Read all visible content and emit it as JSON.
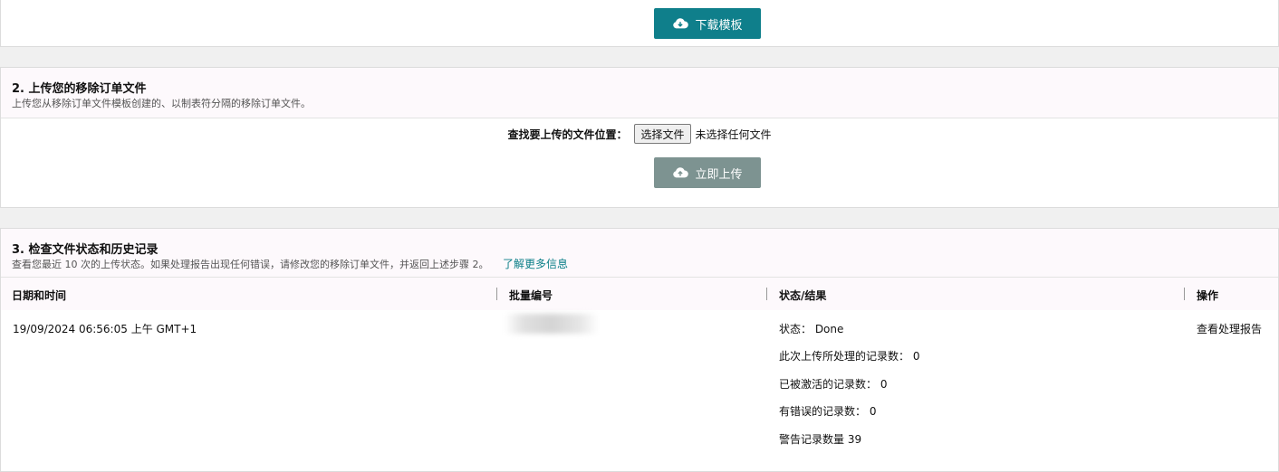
{
  "download": {
    "button_label": "下载模板",
    "icon": "cloud-download-icon"
  },
  "upload": {
    "title": "2. 上传您的移除订单文件",
    "subtitle": "上传您从移除订单文件模板创建的、以制表符分隔的移除订单文件。",
    "file_label": "查找要上传的文件位置：",
    "choose_button": "选择文件",
    "file_status": "未选择任何文件",
    "button_label": "立即上传",
    "icon": "cloud-upload-icon"
  },
  "history": {
    "title": "3. 检查文件状态和历史记录",
    "subtitle": "查看您最近 10 次的上传状态。如果处理报告出现任何错误，请修改您的移除订单文件，并返回上述步骤 2。",
    "learn_more": "了解更多信息",
    "columns": [
      "日期和时间",
      "批量编号",
      "状态/结果",
      "操作"
    ],
    "rows": [
      {
        "datetime": "19/09/2024 06:56:05 上午 GMT+1",
        "status_lines": [
          "状态： Done",
          "此次上传所处理的记录数： 0",
          "已被激活的记录数： 0",
          "有错误的记录数： 0",
          "警告记录数量 39"
        ],
        "action": "查看处理报告"
      }
    ]
  },
  "colors": {
    "accent": "#0f7f8b",
    "disabled": "#7d9391",
    "link": "#0a7e87",
    "section_header_bg": "#fdf9fc"
  }
}
